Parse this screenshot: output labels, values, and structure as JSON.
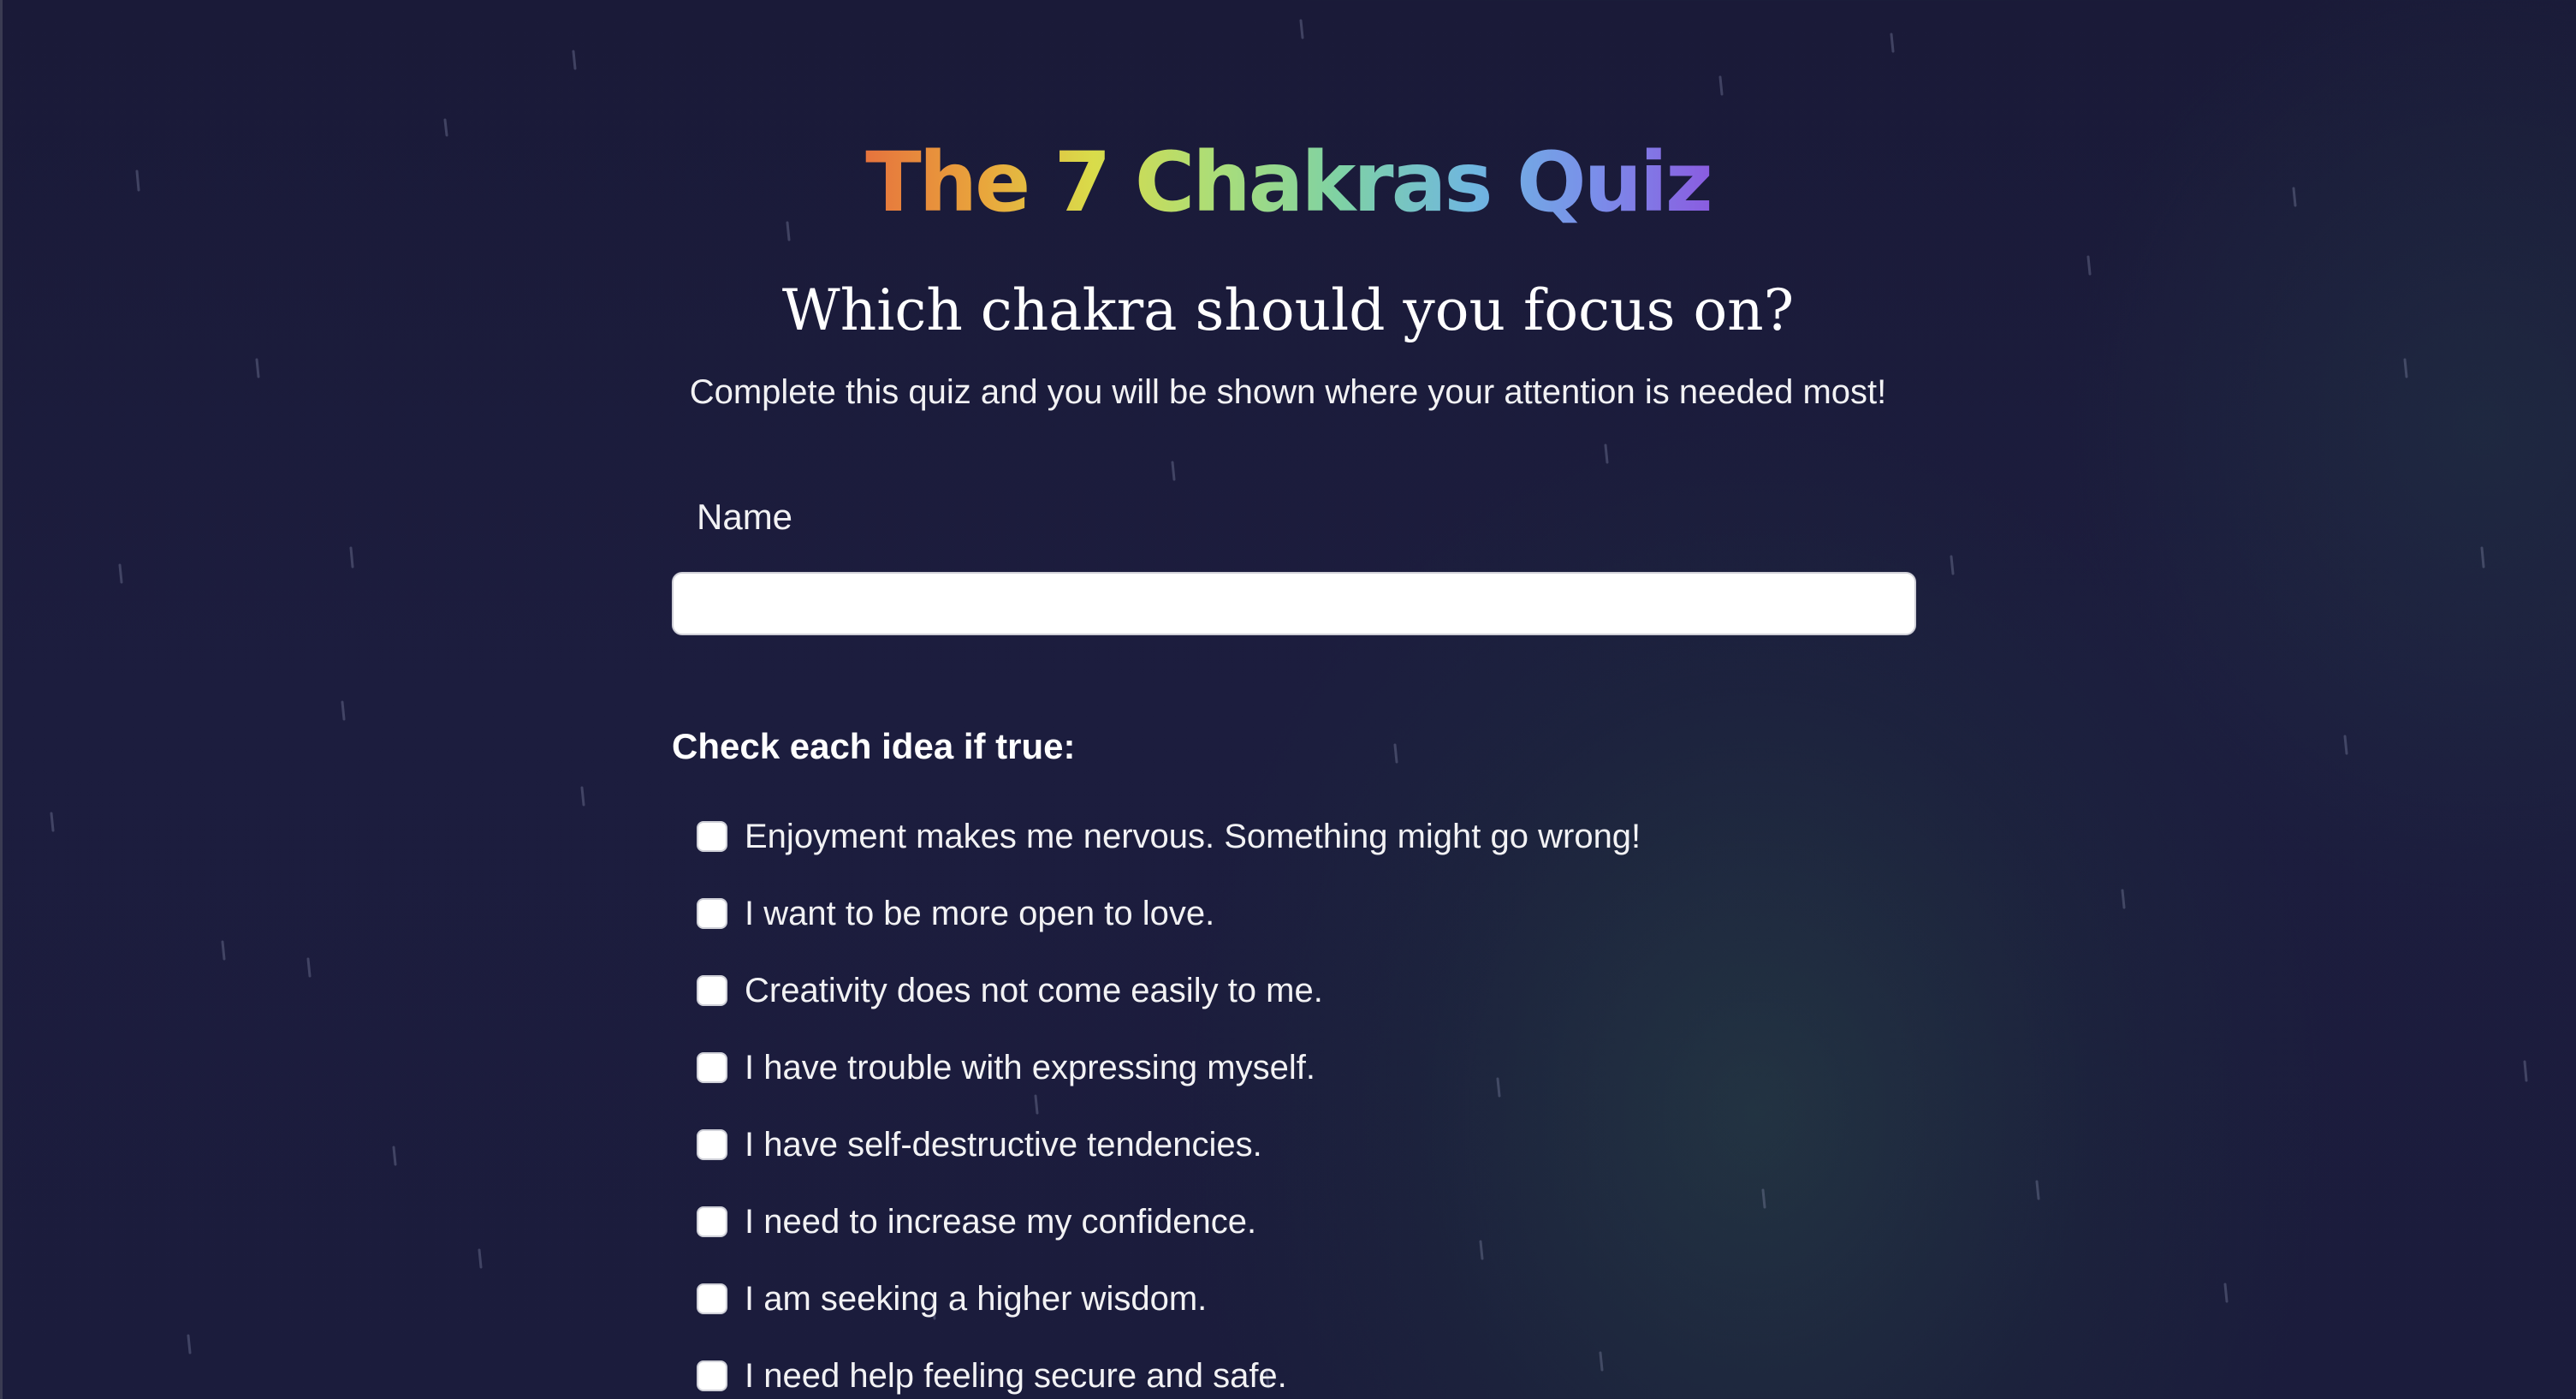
{
  "header": {
    "title": "The 7 Chakras Quiz",
    "subtitle": "Which chakra should you focus on?",
    "intro": "Complete this quiz and you will be shown where your attention is needed most!"
  },
  "form": {
    "name_label": "Name",
    "name_value": "",
    "name_placeholder": "",
    "checklist_heading": "Check each idea if true:",
    "options": [
      {
        "label": "Enjoyment makes me nervous. Something might go wrong!",
        "checked": false
      },
      {
        "label": "I want to be more open to love.",
        "checked": false
      },
      {
        "label": "Creativity does not come easily to me.",
        "checked": false
      },
      {
        "label": "I have trouble with expressing myself.",
        "checked": false
      },
      {
        "label": "I have self-destructive tendencies.",
        "checked": false
      },
      {
        "label": "I need to increase my confidence.",
        "checked": false
      },
      {
        "label": "I am seeking a higher wisdom.",
        "checked": false
      },
      {
        "label": "I need help feeling secure and safe.",
        "checked": false
      }
    ]
  },
  "colors": {
    "background": "#1b1c3c",
    "title_gradient": [
      "#e6733d",
      "#e9a63c",
      "#d9dc4a",
      "#a9dd7a",
      "#7fd2a4",
      "#6fb6e0",
      "#7a8fea",
      "#8a5ce0"
    ],
    "text": "#ffffff",
    "input_background": "#ffffff"
  }
}
